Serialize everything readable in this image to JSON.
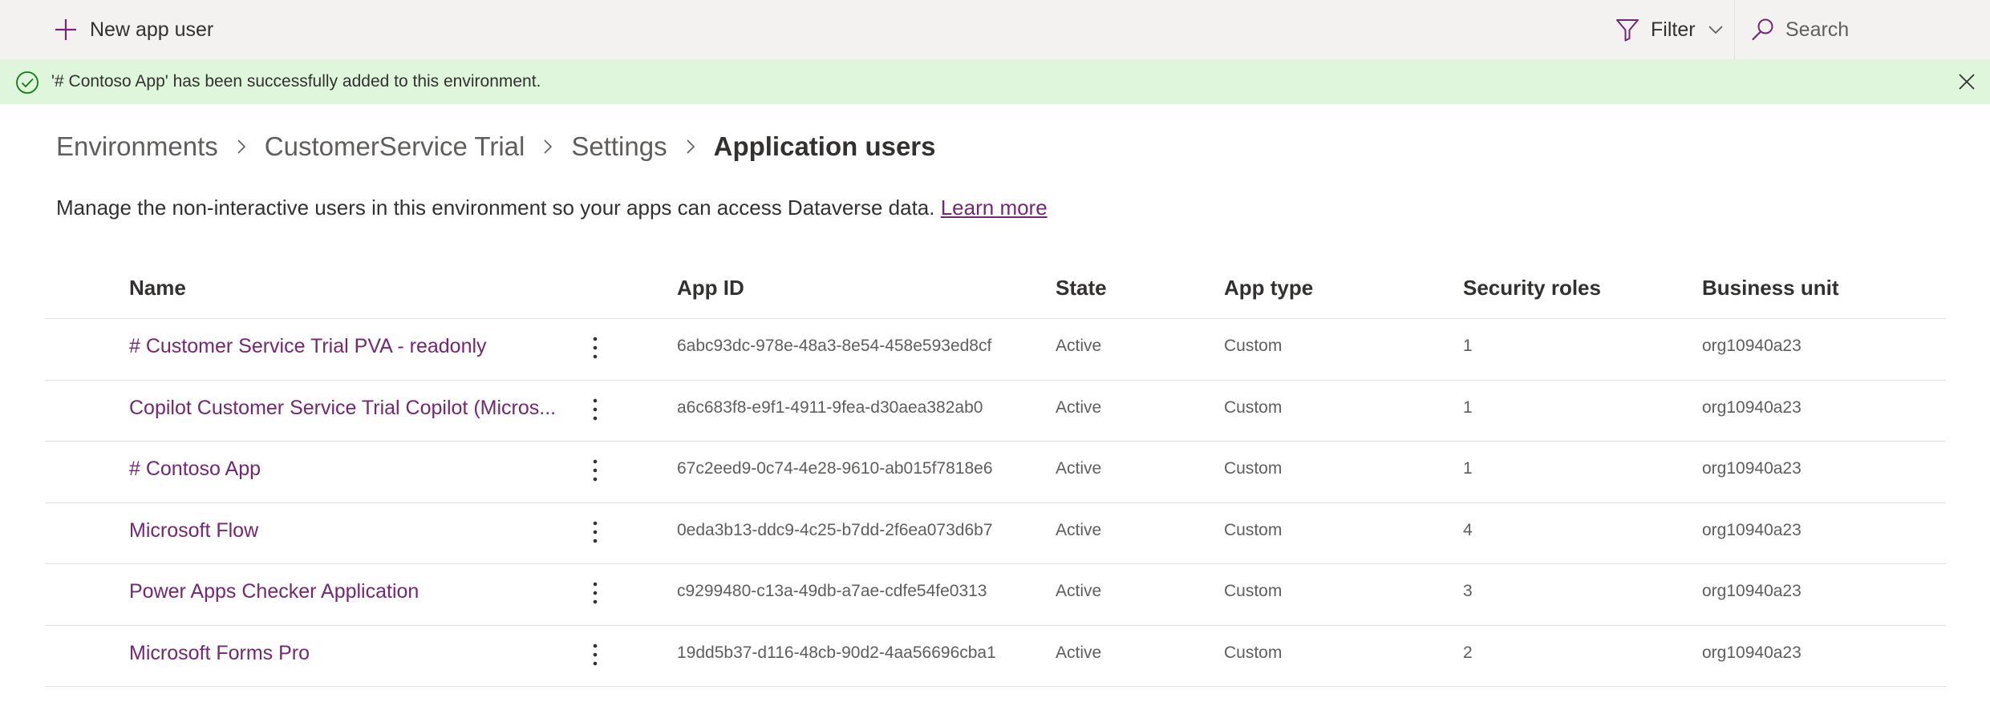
{
  "command_bar": {
    "new_label": "New app user",
    "filter_label": "Filter",
    "search_placeholder": "Search"
  },
  "message_bar": {
    "text": "'# Contoso App' has been successfully added to this environment.",
    "status_color": "#dff6dd"
  },
  "breadcrumb": {
    "items": [
      "Environments",
      "CustomerService Trial",
      "Settings"
    ],
    "current": "Application users"
  },
  "description": {
    "text": "Manage the non-interactive users in this environment so your apps can access Dataverse data.",
    "link": "Learn more"
  },
  "table": {
    "headers": {
      "name": "Name",
      "app_id": "App ID",
      "state": "State",
      "app_type": "App type",
      "security_roles": "Security roles",
      "business_unit": "Business unit"
    },
    "rows": [
      {
        "name": "# Customer Service Trial PVA - readonly",
        "app_id": "6abc93dc-978e-48a3-8e54-458e593ed8cf",
        "state": "Active",
        "app_type": "Custom",
        "security_roles": "1",
        "business_unit": "org10940a23"
      },
      {
        "name": "Copilot Customer Service Trial Copilot (Micros...",
        "app_id": "a6c683f8-e9f1-4911-9fea-d30aea382ab0",
        "state": "Active",
        "app_type": "Custom",
        "security_roles": "1",
        "business_unit": "org10940a23"
      },
      {
        "name": "# Contoso App",
        "app_id": "67c2eed9-0c74-4e28-9610-ab015f7818e6",
        "state": "Active",
        "app_type": "Custom",
        "security_roles": "1",
        "business_unit": "org10940a23"
      },
      {
        "name": "Microsoft Flow",
        "app_id": "0eda3b13-ddc9-4c25-b7dd-2f6ea073d6b7",
        "state": "Active",
        "app_type": "Custom",
        "security_roles": "4",
        "business_unit": "org10940a23"
      },
      {
        "name": "Power Apps Checker Application",
        "app_id": "c9299480-c13a-49db-a7ae-cdfe54fe0313",
        "state": "Active",
        "app_type": "Custom",
        "security_roles": "3",
        "business_unit": "org10940a23"
      },
      {
        "name": "Microsoft Forms Pro",
        "app_id": "19dd5b37-d116-48cb-90d2-4aa56696cba1",
        "state": "Active",
        "app_type": "Custom",
        "security_roles": "2",
        "business_unit": "org10940a23"
      }
    ]
  },
  "colors": {
    "accent": "#742774",
    "success": "#107c10"
  }
}
